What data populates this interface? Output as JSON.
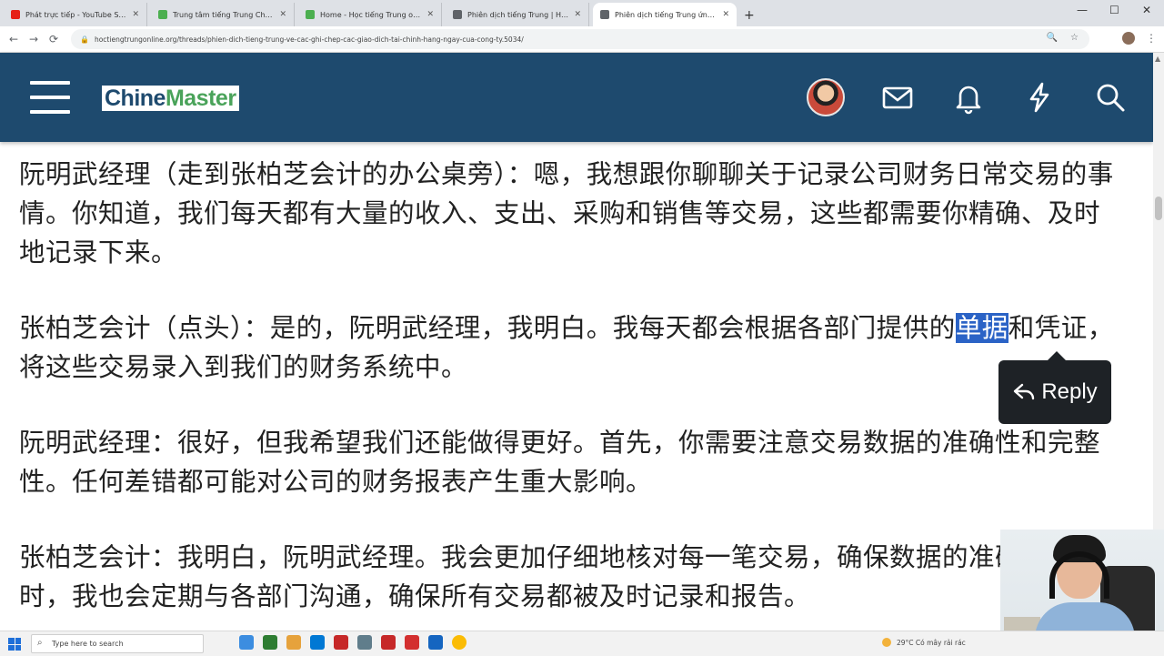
{
  "browser": {
    "tabs": [
      {
        "label": "Phát trực tiếp - YouTube Studio",
        "color": "#e62117"
      },
      {
        "label": "Trung tâm tiếng Trung ChineMaster",
        "color": "#4caf50"
      },
      {
        "label": "Home - Học tiếng Trung online",
        "color": "#4caf50"
      },
      {
        "label": "Phiên dịch tiếng Trung | Học tiếng",
        "color": "#5f6368"
      },
      {
        "label": "Phiên dịch tiếng Trung ứng dụng",
        "color": "#5f6368"
      }
    ],
    "new_tab": "+",
    "url": "hoctiengtrungonline.org/threads/phien-dich-tieng-trung-ve-cac-ghi-chep-cac-giao-dich-tai-chinh-hang-ngay-cua-cong-ty.5034/",
    "window_controls": {
      "minimize": "—",
      "maximize": "☐",
      "close": "✕"
    }
  },
  "site": {
    "logo_part1": "Chine",
    "logo_part2": "Master"
  },
  "content": {
    "paragraphs": [
      {
        "text": "阮明武经理（走到张柏芝会计的办公桌旁）：嗯，我想跟你聊聊关于记录公司财务日常交易的事情。你知道，我们每天都有大量的收入、支出、采购和销售等交易，这些都需要你精确、及时地记录下来。"
      },
      {
        "before": "张柏芝会计（点头）：是的，阮明武经理，我明白。我每天都会根据各部门提供的",
        "highlight": "单据",
        "after": "和凭证，将这些交易录入到我们的财务系统中。"
      },
      {
        "text": "阮明武经理：很好，但我希望我们还能做得更好。首先，你需要注意交易数据的准确性和完整性。任何差错都可能对公司的财务报表产生重大影响。"
      },
      {
        "text": "张柏芝会计：我明白，阮明武经理。我会更加仔细地核对每一笔交易，确保数据的准确性。同时，我也会定期与各部门沟通，确保所有交易都被及时记录和报告。"
      }
    ],
    "reply_label": "Reply"
  },
  "taskbar": {
    "search_placeholder": "Type here to search",
    "weather": "29°C  Có mây rải rác",
    "apps": [
      "#3c8de0",
      "#2e7d32",
      "#e6a23c",
      "#0078d4",
      "#c62828",
      "#607d8b",
      "#c62828",
      "#d32f2f",
      "#1565c0",
      "#fbbc05"
    ]
  }
}
